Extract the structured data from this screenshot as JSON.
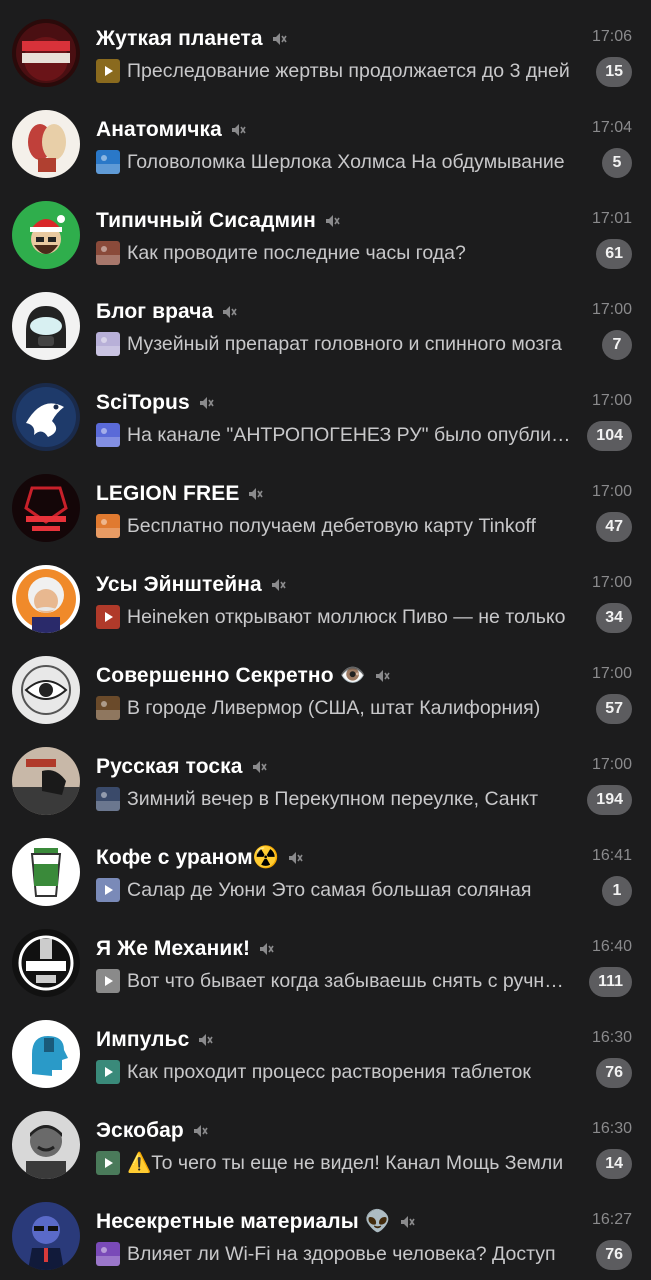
{
  "chats": [
    {
      "name": "Жуткая планета",
      "time": "17:06",
      "preview": "Преследование жертвы продолжается до 3 дней",
      "unread": "15",
      "avatar": "avatar-zhutkaya-planeta",
      "thumb": "video-thumb",
      "thumb_color": "#8a6a1e"
    },
    {
      "name": "Анатомичка",
      "time": "17:04",
      "preview": "Головоломка Шерлока Холмса  На обдумывание",
      "unread": "5",
      "avatar": "avatar-anatomichka",
      "thumb": "image-thumb",
      "thumb_color": "#2a78c8"
    },
    {
      "name": "Типичный Сисадмин",
      "time": "17:01",
      "preview": "Как проводите последние часы года?",
      "unread": "61",
      "avatar": "avatar-tipichny-sisadmin",
      "thumb": "image-thumb",
      "thumb_color": "#8a4a3a"
    },
    {
      "name": "Блог врача",
      "time": "17:00",
      "preview": "Музейный препарат головного и спинного мозга",
      "unread": "7",
      "avatar": "avatar-blog-vracha",
      "thumb": "image-thumb",
      "thumb_color": "#b8b0d8"
    },
    {
      "name": "SciTopus",
      "time": "17:00",
      "preview": "На канале \"АНТРОПОГЕНЕЗ РУ\" было опубликовано",
      "unread": "104",
      "avatar": "avatar-scitopus",
      "thumb": "image-thumb",
      "thumb_color": "#5a6ad8"
    },
    {
      "name": "LEGION FREE",
      "time": "17:00",
      "preview": "Бесплатно получаем дебетовую карту Tinkoff",
      "unread": "47",
      "avatar": "avatar-legion-free",
      "thumb": "image-thumb",
      "thumb_color": "#e07a30"
    },
    {
      "name": "Усы Эйнштейна",
      "time": "17:00",
      "preview": "Heineken открывают моллюск  Пиво — не только",
      "unread": "34",
      "avatar": "avatar-usy-einshteina",
      "thumb": "video-thumb",
      "thumb_color": "#b03a2a"
    },
    {
      "name": "Совершенно Секретно 👁️",
      "time": "17:00",
      "preview": "В городе Ливермор (США, штат Калифорния)",
      "unread": "57",
      "avatar": "avatar-sovershenno-sekretno",
      "thumb": "image-thumb",
      "thumb_color": "#6a4a2a"
    },
    {
      "name": "Русская тоска",
      "time": "17:00",
      "preview": "Зимний вечер в Перекупном переулке, Санкт",
      "unread": "194",
      "avatar": "avatar-russkaya-toska",
      "thumb": "image-thumb",
      "thumb_color": "#3a4a6a"
    },
    {
      "name": "Кофе с ураном☢️",
      "time": "16:41",
      "preview": "Салар де Уюни  Это самая большая соляная",
      "unread": "1",
      "avatar": "avatar-kofe-s-uranom",
      "thumb": "video-thumb",
      "thumb_color": "#7a8ab8"
    },
    {
      "name": "Я Же Механик!",
      "time": "16:40",
      "preview": "Вот что бывает когда забываешь снять с ручника",
      "unread": "111",
      "avatar": "avatar-ya-zhe-mekhanik",
      "thumb": "video-thumb",
      "thumb_color": "#8a8a8a"
    },
    {
      "name": "Импульс",
      "time": "16:30",
      "preview": "Как проходит процесс растворения таблеток",
      "unread": "76",
      "avatar": "avatar-impuls",
      "thumb": "video-thumb",
      "thumb_color": "#3a8a7a"
    },
    {
      "name": "Эскобар",
      "time": "16:30",
      "preview": "⚠️То чего ты еще не видел!  Канал Мощь Земли",
      "unread": "14",
      "avatar": "avatar-eskobar",
      "thumb": "video-thumb",
      "thumb_color": "#4a7a5a"
    },
    {
      "name": "Несекретные материалы 👽",
      "time": "16:27",
      "preview": "Влияет ли Wi-Fi на здоровье человека?  Доступ",
      "unread": "76",
      "avatar": "avatar-nesekretnye-materialy",
      "thumb": "image-thumb",
      "thumb_color": "#7a4ab8"
    }
  ],
  "icons": {
    "mute": "muted-speaker-icon"
  }
}
